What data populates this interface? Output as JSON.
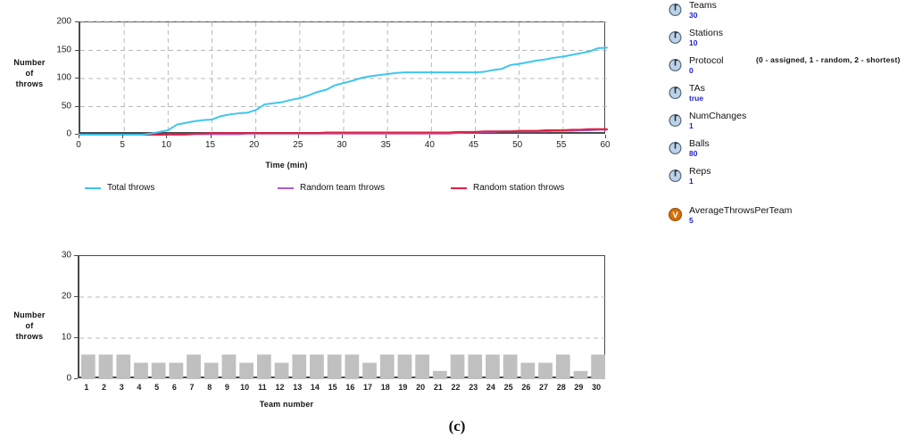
{
  "caption": "(c)",
  "charts": {
    "line": {
      "ylabel_lines": [
        "Number",
        "of",
        "throws"
      ],
      "xlabel": "Time (min)",
      "yticks": [
        "0",
        "50",
        "100",
        "150",
        "200"
      ],
      "xticks": [
        "0",
        "5",
        "10",
        "15",
        "20",
        "25",
        "30",
        "35",
        "40",
        "45",
        "50",
        "55",
        "60"
      ],
      "legend": [
        {
          "label": "Total throws",
          "color": "#3ec6f0"
        },
        {
          "label": "Random team throws",
          "color": "#b05ad0"
        },
        {
          "label": "Random station throws",
          "color": "#e0213f"
        }
      ]
    },
    "bar": {
      "ylabel_lines": [
        "Number",
        "of",
        "throws"
      ],
      "xlabel": "Team number",
      "yticks": [
        "0",
        "10",
        "20",
        "30"
      ],
      "xticks": [
        "1",
        "2",
        "3",
        "4",
        "5",
        "6",
        "7",
        "8",
        "9",
        "10",
        "11",
        "12",
        "13",
        "14",
        "15",
        "16",
        "17",
        "18",
        "19",
        "20",
        "21",
        "22",
        "23",
        "24",
        "25",
        "26",
        "27",
        "28",
        "29",
        "30"
      ]
    }
  },
  "chart_data": [
    {
      "type": "line",
      "title": "",
      "xlabel": "Time (min)",
      "ylabel": "Number of throws",
      "xlim": [
        0,
        60
      ],
      "ylim": [
        0,
        200
      ],
      "xticks": [
        0,
        5,
        10,
        15,
        20,
        25,
        30,
        35,
        40,
        45,
        50,
        55,
        60
      ],
      "yticks": [
        0,
        50,
        100,
        150,
        200
      ],
      "grid": true,
      "legend_position": "below",
      "x": [
        0,
        1,
        2,
        3,
        4,
        5,
        6,
        7,
        8,
        9,
        10,
        11,
        12,
        13,
        14,
        15,
        16,
        17,
        18,
        19,
        20,
        21,
        22,
        23,
        24,
        25,
        26,
        27,
        28,
        29,
        30,
        31,
        32,
        33,
        34,
        35,
        36,
        37,
        38,
        39,
        40,
        41,
        42,
        43,
        44,
        45,
        46,
        47,
        48,
        49,
        50,
        51,
        52,
        53,
        54,
        55,
        56,
        57,
        58,
        59,
        60
      ],
      "series": [
        {
          "name": "Total throws",
          "color": "#3ec6f0",
          "values": [
            0,
            0,
            0,
            0,
            0,
            0,
            0,
            0,
            2,
            5,
            8,
            18,
            21,
            24,
            26,
            27,
            33,
            36,
            38,
            39,
            44,
            54,
            56,
            58,
            62,
            65,
            70,
            76,
            80,
            88,
            92,
            96,
            101,
            104,
            106,
            108,
            110,
            111,
            111,
            111,
            111,
            111,
            111,
            111,
            111,
            111,
            112,
            115,
            117,
            124,
            126,
            129,
            132,
            134,
            137,
            139,
            142,
            145,
            148,
            154,
            155
          ]
        },
        {
          "name": "Random team throws",
          "color": "#b05ad0",
          "values": [
            0,
            0,
            0,
            0,
            0,
            0,
            0,
            0,
            0,
            0,
            0,
            0,
            0,
            1,
            1,
            1,
            1,
            1,
            1,
            2,
            2,
            2,
            2,
            2,
            2,
            2,
            2,
            2,
            2,
            2,
            2,
            2,
            2,
            2,
            2,
            2,
            2,
            2,
            2,
            2,
            2,
            2,
            2,
            3,
            4,
            4,
            5,
            5,
            6,
            6,
            6,
            6,
            6,
            6,
            7,
            7,
            7,
            8,
            8,
            9,
            9
          ]
        },
        {
          "name": "Random station throws",
          "color": "#e0213f",
          "values": [
            0,
            0,
            0,
            0,
            0,
            0,
            0,
            0,
            0,
            0,
            1,
            1,
            1,
            2,
            2,
            3,
            3,
            3,
            3,
            3,
            3,
            3,
            3,
            3,
            3,
            3,
            3,
            3,
            4,
            4,
            4,
            4,
            4,
            4,
            4,
            4,
            4,
            4,
            4,
            4,
            4,
            4,
            4,
            5,
            5,
            5,
            6,
            6,
            6,
            6,
            7,
            7,
            7,
            8,
            8,
            8,
            9,
            9,
            10,
            10,
            10
          ]
        }
      ]
    },
    {
      "type": "bar",
      "title": "",
      "xlabel": "Team number",
      "ylabel": "Number of throws",
      "ylim": [
        0,
        30
      ],
      "yticks": [
        0,
        10,
        20,
        30
      ],
      "grid": true,
      "bar_color": "#c0c0c0",
      "categories": [
        "1",
        "2",
        "3",
        "4",
        "5",
        "6",
        "7",
        "8",
        "9",
        "10",
        "11",
        "12",
        "13",
        "14",
        "15",
        "16",
        "17",
        "18",
        "19",
        "20",
        "21",
        "22",
        "23",
        "24",
        "25",
        "26",
        "27",
        "28",
        "29",
        "30"
      ],
      "values": [
        6,
        6,
        6,
        4,
        4,
        4,
        6,
        4,
        6,
        4,
        6,
        4,
        6,
        6,
        6,
        6,
        4,
        6,
        6,
        6,
        2,
        6,
        6,
        6,
        6,
        4,
        4,
        6,
        2,
        6
      ]
    }
  ],
  "params": {
    "items": [
      {
        "icon": "knob-icon",
        "name": "Teams",
        "value": "30",
        "note": ""
      },
      {
        "icon": "knob-icon",
        "name": "Stations",
        "value": "10",
        "note": ""
      },
      {
        "icon": "knob-icon",
        "name": "Protocol",
        "value": "0",
        "note": "(0 - assigned, 1 - random, 2 - shortest)"
      },
      {
        "icon": "knob-icon",
        "name": "TAs",
        "value": "true",
        "note": ""
      },
      {
        "icon": "knob-icon",
        "name": "NumChanges",
        "value": "1",
        "note": ""
      },
      {
        "icon": "knob-icon",
        "name": "Balls",
        "value": "80",
        "note": ""
      },
      {
        "icon": "knob-icon",
        "name": "Reps",
        "value": "1",
        "note": ""
      }
    ],
    "monitor": {
      "icon": "monitor-v-icon",
      "name": "AverageThrowsPerTeam",
      "value": "5"
    }
  },
  "colors": {
    "total_throws": "#3ec6f0",
    "random_team": "#b05ad0",
    "random_station": "#e0213f",
    "bar_fill": "#c0c0c0",
    "value_text": "#2222cc",
    "monitor_icon": "#d4700a"
  }
}
